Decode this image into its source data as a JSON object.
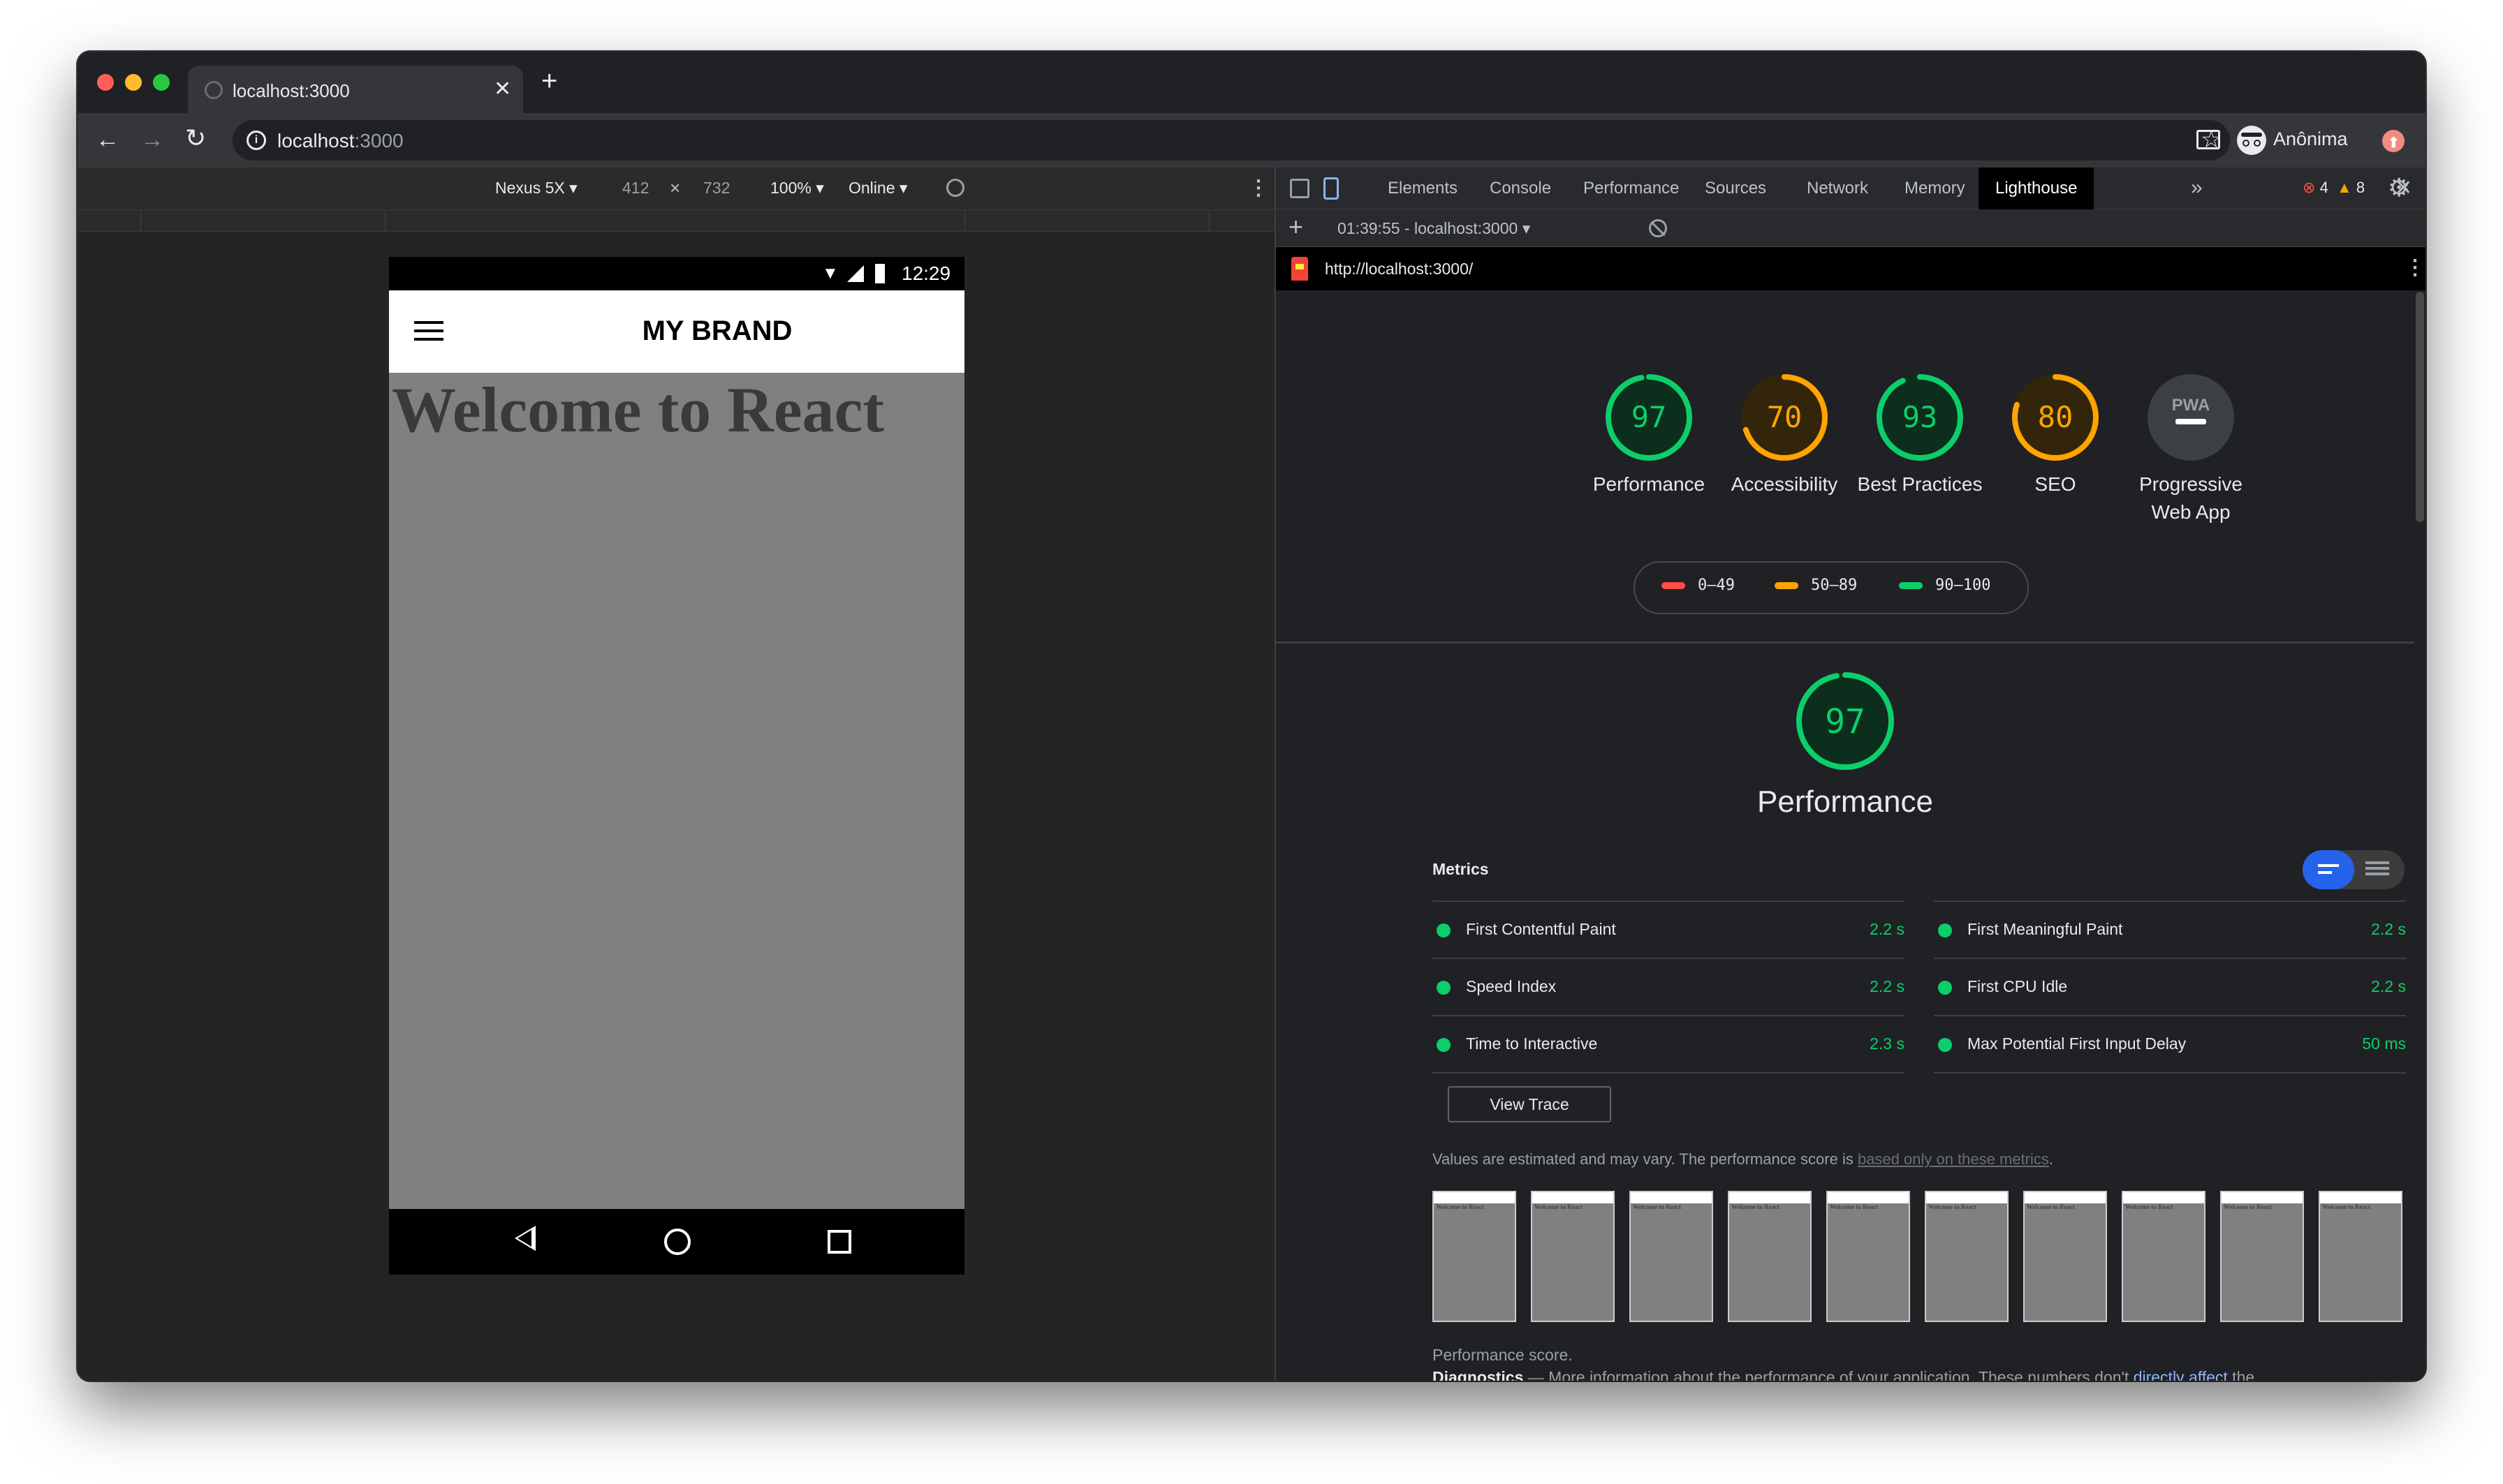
{
  "browser": {
    "tab_title": "localhost:3000",
    "url_host": "localhost",
    "url_port": ":3000",
    "profile_name": "Anônima"
  },
  "device_toolbar": {
    "device": "Nexus 5X",
    "width": "412",
    "times": "×",
    "height": "732",
    "zoom": "100%",
    "network": "Online"
  },
  "phone": {
    "time": "12:29",
    "brand": "MY BRAND",
    "heading": "Welcome to React"
  },
  "devtools": {
    "tabs": [
      "Elements",
      "Console",
      "Performance",
      "Sources",
      "Network",
      "Memory",
      "Lighthouse"
    ],
    "active_tab": "Lighthouse",
    "error_count": "4",
    "warning_count": "8",
    "report_selector": "01:39:55 - localhost:3000",
    "report_url": "http://localhost:3000/"
  },
  "lighthouse": {
    "categories": [
      {
        "score": "97",
        "label": "Performance",
        "color": "#0cce6b",
        "ring": 0.97
      },
      {
        "score": "70",
        "label": "Accessibility",
        "color": "#ffa400",
        "ring": 0.7
      },
      {
        "score": "93",
        "label": "Best Practices",
        "color": "#0cce6b",
        "ring": 0.93
      },
      {
        "score": "80",
        "label": "SEO",
        "color": "#ffa400",
        "ring": 0.8
      },
      {
        "score": "PWA",
        "label": "Progressive Web App",
        "color": "#9aa0a6",
        "ring": 0
      }
    ],
    "legend": [
      {
        "range": "0–49",
        "color": "#ff4e42"
      },
      {
        "range": "50–89",
        "color": "#ffa400"
      },
      {
        "range": "90–100",
        "color": "#0cce6b"
      }
    ],
    "perf_score": "97",
    "perf_title": "Performance",
    "metrics_title": "Metrics",
    "metrics": [
      {
        "name": "First Contentful Paint",
        "value": "2.2 s"
      },
      {
        "name": "First Meaningful Paint",
        "value": "2.2 s"
      },
      {
        "name": "Speed Index",
        "value": "2.2 s"
      },
      {
        "name": "First CPU Idle",
        "value": "2.2 s"
      },
      {
        "name": "Time to Interactive",
        "value": "2.3 s"
      },
      {
        "name": "Max Potential First Input Delay",
        "value": "50 ms"
      }
    ],
    "view_trace": "View Trace",
    "estimate_text": "Values are estimated and may vary. The performance score is ",
    "estimate_link": "based only on these metrics",
    "estimate_end": ".",
    "diagnostics_title": "Diagnostics",
    "diagnostics_dash": "—",
    "diagnostics_text": "More information about the performance of your application. These numbers don't ",
    "diagnostics_link": "directly affect",
    "diagnostics_end": " the",
    "diagnostics_line2": "Performance score.",
    "filmstrip_count": 10
  }
}
